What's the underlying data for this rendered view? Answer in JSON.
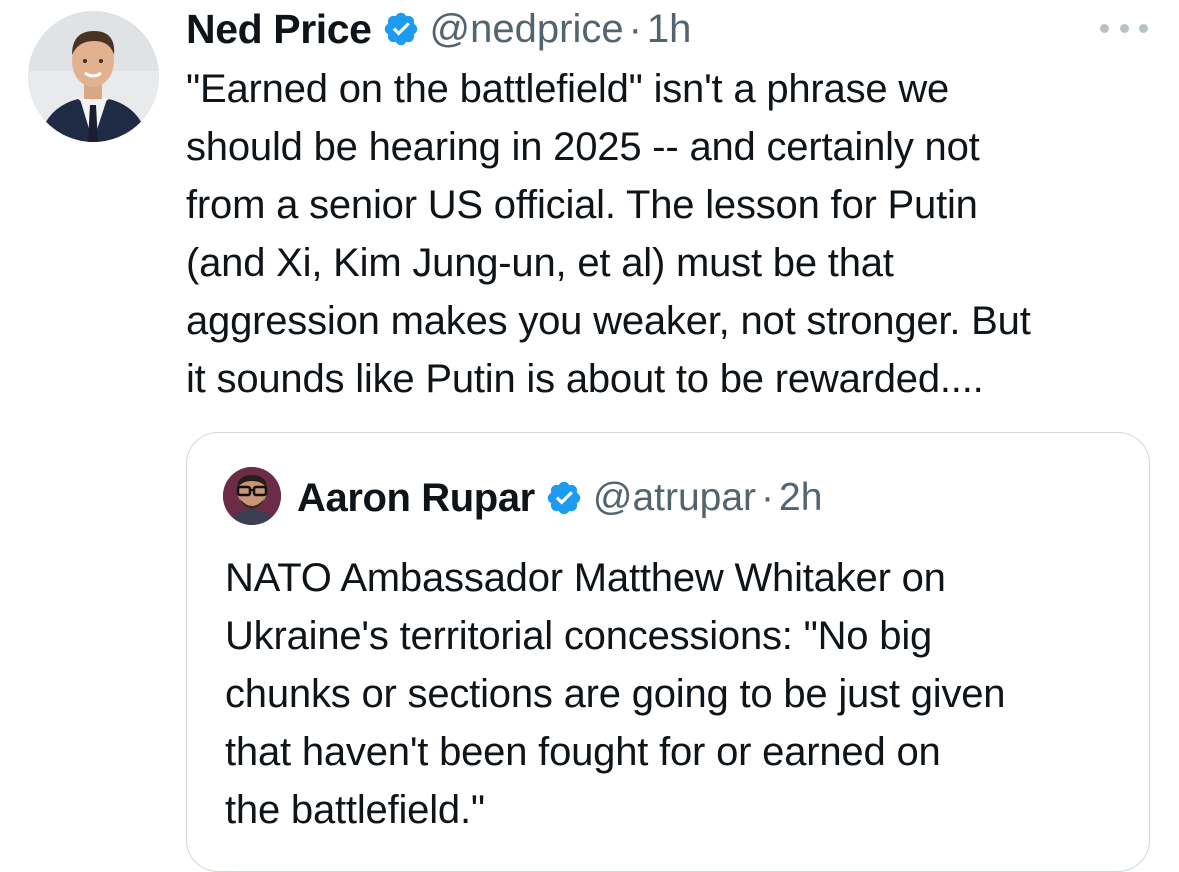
{
  "tweet": {
    "author_name": "Ned Price",
    "author_handle": "@nedprice",
    "separator": "·",
    "time": "1h",
    "text": "\"Earned on the battlefield\" isn't a phrase we\nshould be hearing in 2025 -- and certainly not\nfrom a senior US official. The lesson for Putin\n(and Xi, Kim Jung-un, et al) must be that\naggression makes you weaker, not stronger. But\nit sounds like Putin is about to be rewarded....",
    "verified_icon": "verified-badge-icon",
    "more_icon": "more-options-icon"
  },
  "quoted_tweet": {
    "author_name": "Aaron Rupar",
    "author_handle": "@atrupar",
    "separator": "·",
    "time": "2h",
    "text": "NATO Ambassador Matthew Whitaker on\nUkraine's territorial concessions: \"No big\nchunks or sections are going to be just given\nthat haven't been fought for or earned on\nthe battlefield.\""
  },
  "colors": {
    "text": "#0f1419",
    "secondary_text": "#536471",
    "verified_blue": "#1d9bf0",
    "border": "#cfd9de",
    "background": "#ffffff"
  }
}
